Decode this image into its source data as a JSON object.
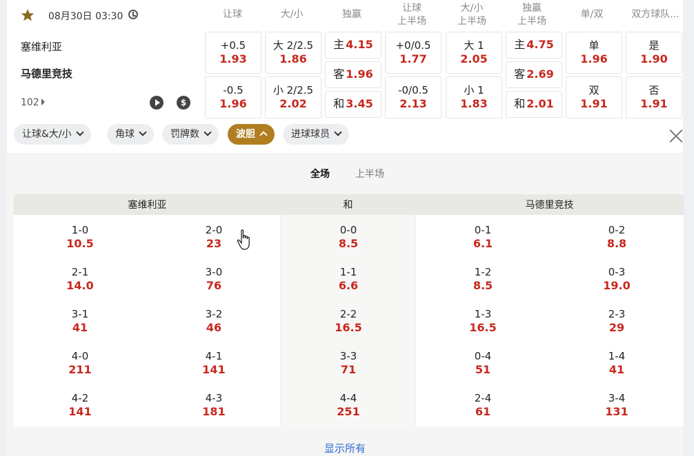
{
  "match": {
    "time": "08月30日 03:30",
    "home": "塞维利亚",
    "away": "马德里竞技",
    "more_count": "102"
  },
  "columns": [
    "让球",
    "大/小",
    "独赢",
    "让球\n上半场",
    "大/小\n上半场",
    "独赢\n上半场",
    "单/双",
    "双方球队..."
  ],
  "markets": {
    "handicap": [
      {
        "label": "+0.5",
        "odd": "1.93"
      },
      {
        "label": "-0.5",
        "odd": "1.96"
      }
    ],
    "total": [
      {
        "label": "大 2/2.5",
        "odd": "1.86"
      },
      {
        "label": "小 2/2.5",
        "odd": "2.02"
      }
    ],
    "moneyline": [
      {
        "label": "主",
        "odd": "4.15"
      },
      {
        "label": "客",
        "odd": "1.96"
      },
      {
        "label": "和",
        "odd": "3.45"
      }
    ],
    "handicap_half": [
      {
        "label": "+0/0.5",
        "odd": "1.77"
      },
      {
        "label": "-0/0.5",
        "odd": "2.13"
      }
    ],
    "total_half": [
      {
        "label": "大 1",
        "odd": "2.05"
      },
      {
        "label": "小 1",
        "odd": "1.83"
      }
    ],
    "moneyline_half": [
      {
        "label": "主",
        "odd": "4.75"
      },
      {
        "label": "客",
        "odd": "2.69"
      },
      {
        "label": "和",
        "odd": "2.01"
      }
    ],
    "odd_even": [
      {
        "label": "单",
        "odd": "1.96"
      },
      {
        "label": "双",
        "odd": "1.91"
      }
    ],
    "btts": [
      {
        "label": "是",
        "odd": "1.90"
      },
      {
        "label": "否",
        "odd": "1.91"
      }
    ]
  },
  "filter_tabs": [
    {
      "label": "让球&大/小",
      "active": false
    },
    {
      "label": "角球",
      "active": false
    },
    {
      "label": "罚牌数",
      "active": false
    },
    {
      "label": "波胆",
      "active": true
    },
    {
      "label": "进球球员",
      "active": false
    }
  ],
  "period_tabs": {
    "full": "全场",
    "half": "上半场"
  },
  "correct_score": {
    "headers": {
      "home": "塞维利亚",
      "draw": "和",
      "away": "马德里竞技"
    },
    "home_a": [
      {
        "score": "1-0",
        "odd": "10.5"
      },
      {
        "score": "2-1",
        "odd": "14.0"
      },
      {
        "score": "3-1",
        "odd": "41"
      },
      {
        "score": "4-0",
        "odd": "211"
      },
      {
        "score": "4-2",
        "odd": "141"
      }
    ],
    "home_b": [
      {
        "score": "2-0",
        "odd": "23"
      },
      {
        "score": "3-0",
        "odd": "76"
      },
      {
        "score": "3-2",
        "odd": "46"
      },
      {
        "score": "4-1",
        "odd": "141"
      },
      {
        "score": "4-3",
        "odd": "181"
      }
    ],
    "draw": [
      {
        "score": "0-0",
        "odd": "8.5"
      },
      {
        "score": "1-1",
        "odd": "6.6"
      },
      {
        "score": "2-2",
        "odd": "16.5"
      },
      {
        "score": "3-3",
        "odd": "71"
      },
      {
        "score": "4-4",
        "odd": "251"
      }
    ],
    "away_a": [
      {
        "score": "0-1",
        "odd": "6.1"
      },
      {
        "score": "1-2",
        "odd": "8.5"
      },
      {
        "score": "1-3",
        "odd": "16.5"
      },
      {
        "score": "0-4",
        "odd": "51"
      },
      {
        "score": "2-4",
        "odd": "61"
      }
    ],
    "away_b": [
      {
        "score": "0-2",
        "odd": "8.8"
      },
      {
        "score": "0-3",
        "odd": "19.0"
      },
      {
        "score": "2-3",
        "odd": "29"
      },
      {
        "score": "1-4",
        "odd": "41"
      },
      {
        "score": "3-4",
        "odd": "131"
      }
    ]
  },
  "show_all_label": "显示所有",
  "colors": {
    "accent": "#b07e21",
    "odd": "#c8281e",
    "link": "#2a6fd0"
  }
}
